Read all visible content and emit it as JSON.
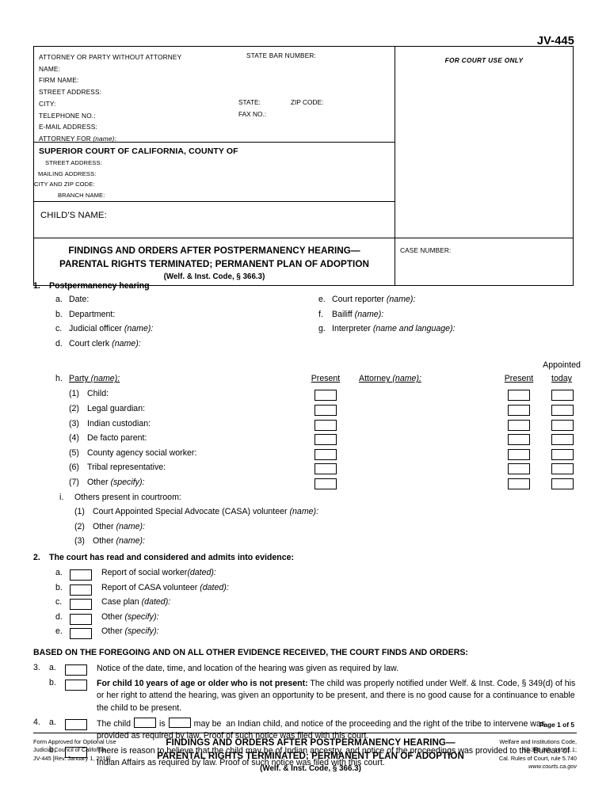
{
  "form_number": "JV-445",
  "caption": {
    "attorney": {
      "header": "ATTORNEY OR PARTY WITHOUT ATTORNEY",
      "state_bar_label": "STATE BAR NUMBER:",
      "name_label": "NAME:",
      "firm_label": "FIRM NAME:",
      "street_label": "STREET ADDRESS:",
      "city_label": "CITY:",
      "state_label": "STATE:",
      "zip_label": "ZIP CODE:",
      "telephone_label": "TELEPHONE NO.:",
      "fax_label": "FAX NO.:",
      "email_label": "E-MAIL ADDRESS:",
      "attorney_for_label": "ATTORNEY FOR",
      "attorney_for_hint": "(name):"
    },
    "court": {
      "title": "SUPERIOR COURT OF CALIFORNIA, COUNTY OF",
      "street_label": "STREET ADDRESS:",
      "mailing_label": "MAILING ADDRESS:",
      "city_zip_label": "CITY AND ZIP CODE:",
      "branch_label": "BRANCH NAME:"
    },
    "child_name_label": "CHILD'S NAME:",
    "title_line1": "FINDINGS AND ORDERS AFTER POSTPERMANENCY HEARING—",
    "title_line2": "PARENTAL RIGHTS TERMINATED; PERMANENT PLAN OF ADOPTION",
    "title_line3": "(Welf. & Inst. Code, § 366.3)",
    "court_use_label": "FOR COURT USE ONLY",
    "case_number_label": "CASE NUMBER:"
  },
  "section1": {
    "number": "1.",
    "heading": "Postpermanency hearing",
    "left_items": [
      {
        "letter": "a.",
        "label": "Date:"
      },
      {
        "letter": "b.",
        "label": "Department:"
      },
      {
        "letter": "c.",
        "label": "Judicial officer ",
        "hint": "(name):"
      },
      {
        "letter": "d.",
        "label": "Court clerk ",
        "hint": "(name):"
      }
    ],
    "right_items": [
      {
        "letter": "e.",
        "label": "Court reporter ",
        "hint": "(name):"
      },
      {
        "letter": "f.",
        "label": "Bailiff ",
        "hint": "(name):"
      },
      {
        "letter": "g.",
        "label": "Interpreter ",
        "hint": "(name and language):"
      }
    ],
    "party_section": {
      "letter": "h.",
      "label": "Party ",
      "hint": "(name):",
      "col_present_1": "Present",
      "col_attorney": "Attorney ",
      "col_attorney_hint": "(name):",
      "col_present_2": "Present",
      "col_appointed_top": "Appointed",
      "col_appointed_bottom": "today",
      "rows": [
        {
          "num": "(1)",
          "label": "Child:"
        },
        {
          "num": "(2)",
          "label": "Legal guardian:"
        },
        {
          "num": "(3)",
          "label": "Indian custodian:"
        },
        {
          "num": "(4)",
          "label": "De facto parent:"
        },
        {
          "num": "(5)",
          "label": "County agency social worker:"
        },
        {
          "num": "(6)",
          "label": "Tribal representative:"
        },
        {
          "num": "(7)",
          "label": "Other ",
          "hint": "(specify):"
        }
      ]
    },
    "others_section": {
      "letter": "i.",
      "label": "Others present in courtroom:",
      "rows": [
        {
          "num": "(1)",
          "label": "Court Appointed Special Advocate (CASA) volunteer ",
          "hint": "(name):"
        },
        {
          "num": "(2)",
          "label": "Other ",
          "hint": "(name):"
        },
        {
          "num": "(3)",
          "label": "Other ",
          "hint": "(name):"
        }
      ]
    }
  },
  "section2": {
    "number": "2.",
    "heading": "The court has read and considered and admits into evidence:",
    "rows": [
      {
        "letter": "a.",
        "label": "Report of social worker",
        "hint": "(dated):"
      },
      {
        "letter": "b.",
        "label": "Report of CASA volunteer ",
        "hint": "(dated):"
      },
      {
        "letter": "c.",
        "label": "Case plan ",
        "hint": "(dated):"
      },
      {
        "letter": "d.",
        "label": "Other ",
        "hint": "(specify):"
      },
      {
        "letter": "e.",
        "label": "Other ",
        "hint": "(specify):"
      }
    ]
  },
  "based_on_heading": "BASED ON THE FOREGOING AND ON ALL OTHER EVIDENCE RECEIVED, THE COURT FINDS AND ORDERS:",
  "section3": {
    "number": "3.",
    "a": {
      "letter": "a.",
      "text": "Notice of the date, time, and location of the hearing was given as required by law."
    },
    "b": {
      "letter": "b.",
      "bold_lead": "For child 10 years of age or older who is not present:",
      "text": " The child was properly notified under Welf. & Inst. Code, § 349(d) of his or her right to attend the hearing, was given an opportunity to be present, and there is no good cause for a continuance to enable the child to be present."
    }
  },
  "section4": {
    "number": "4.",
    "a": {
      "letter": "a.",
      "text_part1": "The  child",
      "text_part2": "is",
      "text_part3": "may be",
      "text_part4": "an Indian child, and notice of the proceeding and the right of the tribe to intervene was provided as required by law. Proof of such notice was filed with this court."
    },
    "b": {
      "letter": "b.",
      "text": "There is reason to believe that the child may be of Indian ancestry, and notice of the proceedings was provided to the Bureau of Indian Affairs as required by law. Proof of such notice was filed with this court."
    }
  },
  "footer": {
    "page_label": "Page 1 of 5",
    "left_line1": "Form Approved for Optional Use",
    "left_line2": "Judicial Council of California",
    "left_line3": "JV-445 [Rev. January 1, 2018]",
    "center_line1": "FINDINGS AND ORDERS AFTER POSTPERMANENCY HEARING—",
    "center_line2": "PARENTAL RIGHTS TERMINATED; PERMANENT PLAN OF ADOPTION",
    "center_line3": "(Welf. & Inst. Code, § 366.3)",
    "right_line1": "Welfare and Institutions Code,",
    "right_line2": "§§ 366.3(f), 16501.1;",
    "right_line3": "Cal. Rules of Court, rule 5.740",
    "right_line4": "www.courts.ca.gov"
  }
}
